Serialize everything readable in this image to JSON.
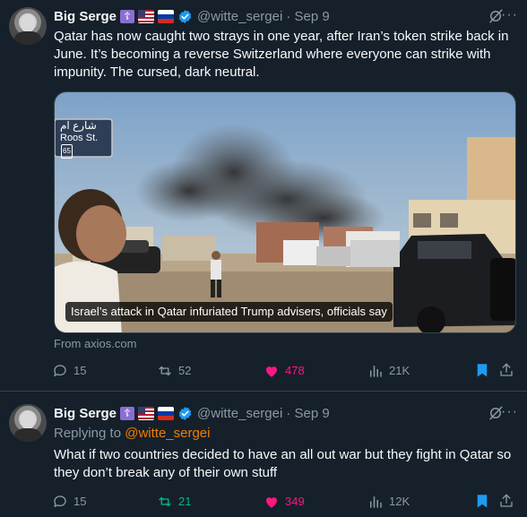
{
  "colors": {
    "background": "#15202b",
    "text": "#f7f9f9",
    "muted": "#8b98a5",
    "divider": "#38444d",
    "like": "#f91880",
    "retweet": "#00ba7c",
    "accent": "#1d9bf0",
    "mention": "#f07d00"
  },
  "tweets": [
    {
      "author": {
        "name": "Big Serge",
        "badges": [
          "orthodox-cross-emoji",
          "us-flag-emoji",
          "russia-flag-emoji",
          "verified-badge-icon"
        ],
        "handle": "@witte_sergei",
        "date": "· Sep 9"
      },
      "text": "Qatar has now caught two strays in one year, after Iran’s token strike back in June. It’s becoming a reverse Switzerland where everyone can strike with impunity. The cursed, dark neutral.",
      "card": {
        "sign_arabic": "شارع ام",
        "sign_latin": "Roos St.",
        "sign_number": "65",
        "caption": "Israel’s attack in Qatar infuriated Trump advisers, officials say",
        "source": "From axios.com"
      },
      "actions": {
        "replies": "15",
        "reposts": "52",
        "likes": "478",
        "views": "21K",
        "liked": true,
        "reposted": false,
        "bookmarked": true
      }
    },
    {
      "author": {
        "name": "Big Serge",
        "badges": [
          "orthodox-cross-emoji",
          "us-flag-emoji",
          "russia-flag-emoji",
          "verified-badge-icon"
        ],
        "handle": "@witte_sergei",
        "date": "· Sep 9"
      },
      "replying_to_label": "Replying to",
      "replying_to_handle": "@witte_sergei",
      "text": "What if two countries decided to have an all out war but they fight in Qatar so they don’t break any of their own stuff",
      "actions": {
        "replies": "15",
        "reposts": "21",
        "likes": "349",
        "views": "12K",
        "liked": true,
        "reposted": true,
        "bookmarked": true
      }
    }
  ]
}
